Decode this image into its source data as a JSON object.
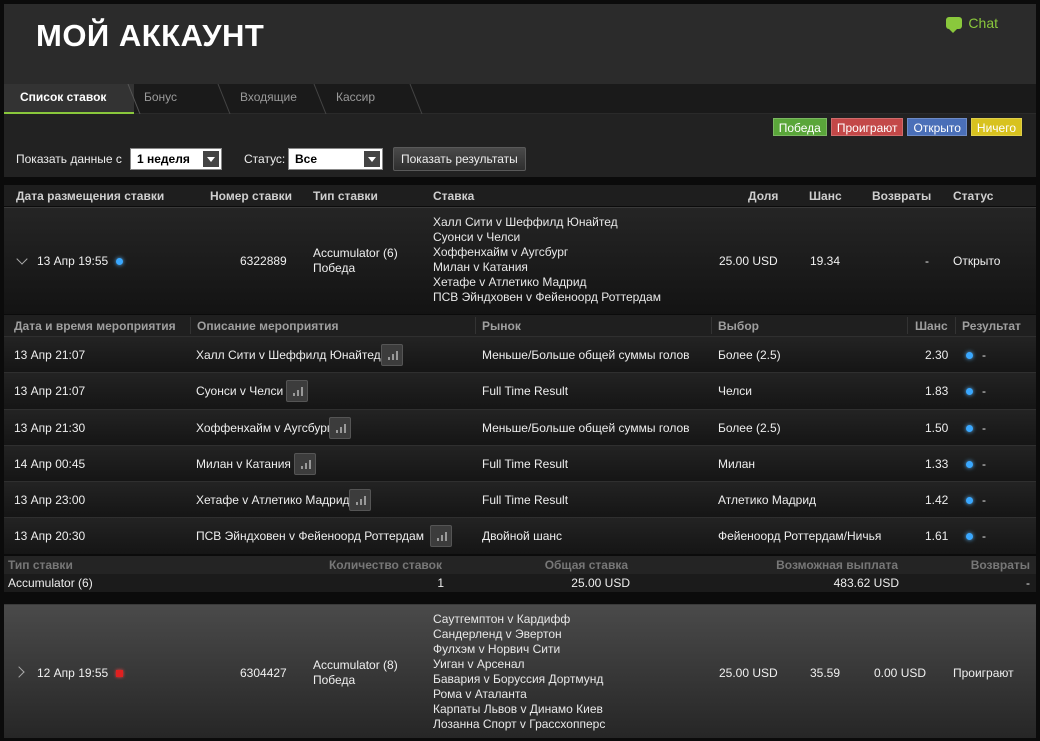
{
  "header": {
    "title": "МОЙ АККАУНТ",
    "chat_label": "Chat"
  },
  "tabs": [
    "Список ставок",
    "Бонус",
    "Входящие",
    "Кассир"
  ],
  "legend": {
    "win": "Победа",
    "lose": "Проиграют",
    "open": "Открыто",
    "draw": "Ничего"
  },
  "filters": {
    "period_label": "Показать данные с",
    "period_value": "1 неделя",
    "status_label": "Статус:",
    "status_value": "Все",
    "show_button": "Показать результаты"
  },
  "columns": {
    "date": "Дата размещения ставки",
    "number": "Номер ставки",
    "type": "Тип ставки",
    "bet": "Ставка",
    "stake": "Доля",
    "odds": "Шанс",
    "returns": "Возвраты",
    "status": "Статус"
  },
  "bets": [
    {
      "date": "13 Апр 19:55",
      "number": "6322889",
      "type": "Accumulator (6)",
      "type2": "Победа",
      "matches": [
        "Халл Сити v Шеффилд Юнайтед",
        "Суонси v Челси",
        "Хоффенхайм v Аугсбург",
        "Милан v Катания",
        "Хетафе v Атлетико Мадрид",
        "ПСВ Эйндховен v Фейеноорд Роттердам"
      ],
      "stake": "25.00 USD",
      "odds": "19.34",
      "returns": "-",
      "status": "Открыто"
    },
    {
      "date": "12 Апр 19:55",
      "number": "6304427",
      "type": "Accumulator (8)",
      "type2": "Победа",
      "matches": [
        "Саутгемптон v Кардифф",
        "Сандерленд v Эвертон",
        "Фулхэм v Норвич Сити",
        "Уиган v Арсенал",
        "Бавария v Боруссия Дортмунд",
        "Рома v Аталанта",
        "Карпаты Львов v Динамо Киев",
        "Лозанна Спорт v Грассхопперс"
      ],
      "stake": "25.00 USD",
      "odds": "35.59",
      "returns": "0.00 USD",
      "status": "Проиграют"
    }
  ],
  "detail": {
    "columns": {
      "datetime": "Дата и время мероприятия",
      "description": "Описание мероприятия",
      "market": "Рынок",
      "selection": "Выбор",
      "odds": "Шанс",
      "result": "Результат"
    },
    "rows": [
      {
        "datetime": "13 Апр 21:07",
        "description": "Халл Сити v Шеффилд Юнайтед",
        "market": "Меньше/Больше общей суммы голов",
        "selection": "Более (2.5)",
        "odds": "2.30",
        "result": "-"
      },
      {
        "datetime": "13 Апр 21:07",
        "description": "Суонси v Челси",
        "market": "Full Time Result",
        "selection": "Челси",
        "odds": "1.83",
        "result": "-"
      },
      {
        "datetime": "13 Апр 21:30",
        "description": "Хоффенхайм v Аугсбург",
        "market": "Меньше/Больше общей суммы голов",
        "selection": "Более (2.5)",
        "odds": "1.50",
        "result": "-"
      },
      {
        "datetime": "14 Апр 00:45",
        "description": "Милан v Катания",
        "market": "Full Time Result",
        "selection": "Милан",
        "odds": "1.33",
        "result": "-"
      },
      {
        "datetime": "13 Апр 23:00",
        "description": "Хетафе v Атлетико Мадрид",
        "market": "Full Time Result",
        "selection": "Атлетико Мадрид",
        "odds": "1.42",
        "result": "-"
      },
      {
        "datetime": "13 Апр 20:30",
        "description": "ПСВ Эйндховен v Фейеноорд Роттердам",
        "market": "Двойной шанс",
        "selection": "Фейеноорд Роттердам/Ничья",
        "odds": "1.61",
        "result": "-"
      }
    ]
  },
  "summary": {
    "columns": {
      "type": "Тип ставки",
      "count": "Количество ставок",
      "total": "Общая ставка",
      "payout": "Возможная выплата",
      "returns": "Возвраты"
    },
    "row": {
      "type": "Accumulator (6)",
      "count": "1",
      "total": "25.00 USD",
      "payout": "483.62 USD",
      "returns": "-"
    }
  },
  "colors": {
    "accent": "#8ac83c",
    "win": "#5aa63a",
    "lose": "#c34848",
    "open": "#4a6fb8",
    "draw": "#d8c21f"
  }
}
